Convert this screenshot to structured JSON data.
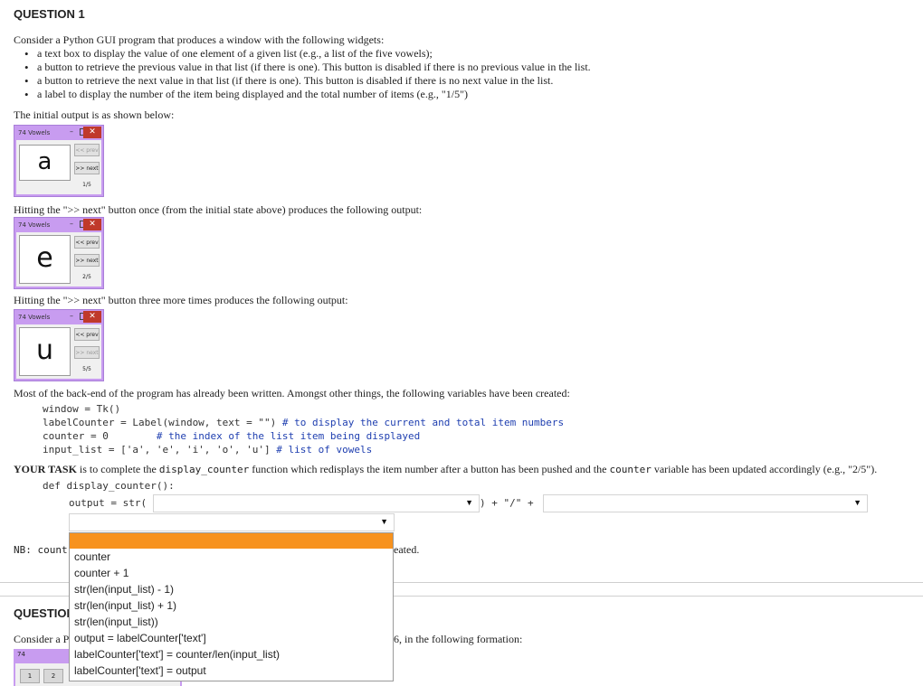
{
  "q1": {
    "title": "QUESTION 1",
    "intro": "Consider a Python GUI program that produces a window with the following widgets:",
    "bullets": [
      "a text box to display the value of one element of a given list (e.g., a list of the five vowels);",
      "a button to retrieve the previous value in that list (if there is one).  This button is disabled if there is no previous value in the list.",
      "a button to retrieve the next value in that list (if there is one).  This button is disabled if there is no next value in the list.",
      "a label to display the number of the item being displayed and the total number of items (e.g., \"1/5\")"
    ],
    "initial_text": "The initial output is as shown below:",
    "after_one_text": "Hitting the \">> next\" button once (from the initial state above) produces the following output:",
    "after_three_text": "Hitting the \">> next\" button three more times produces the following output:",
    "windows": [
      {
        "title": "Vowels",
        "letter": "a",
        "prev": "<< prev",
        "next": ">> next",
        "count": "1/5"
      },
      {
        "title": "Vowels",
        "letter": "e",
        "prev": "<< prev",
        "next": ">> next",
        "count": "2/5"
      },
      {
        "title": "Vowels",
        "letter": "u",
        "prev": "<< prev",
        "next": ">> next",
        "count": "5/5"
      }
    ],
    "backend_text": "Most of the back-end of the program has already been written.  Amongst other things, the following variables have been created:",
    "code": {
      "l1": "window = Tk()",
      "l2a": "labelCounter = Label(window, text = \"\") ",
      "l2b": "# to display the current and total item numbers",
      "l3a": "counter = 0        ",
      "l3b": "# the index of the list item being displayed",
      "l4a": "input_list = ['a', 'e', 'i', 'o', 'u'] ",
      "l4b": "# list of vowels"
    },
    "task_bold": "YOUR TASK",
    "task_1": " is to complete the ",
    "task_code1": "display_counter",
    "task_2": " function which redisplays the item number after a button has been pushed and the ",
    "task_code2": "counter",
    "task_3": " variable has been updated accordingly (e.g., \"2/5\").",
    "def_line": "def display_counter():",
    "output_line": "output = str(",
    "concat": ") + \"/\" + ",
    "nb_start": "NB: count",
    "nb_end": "eated."
  },
  "dropdown": {
    "selected": "",
    "options": [
      "counter",
      "counter + 1",
      "str(len(input_list) - 1)",
      "str(len(input_list) + 1)",
      "str(len(input_list))",
      "output = labelCounter['text']",
      "labelCounter['text'] = counter/len(input_list)",
      "labelCounter['text'] = output"
    ]
  },
  "q2": {
    "title": "QUESTION",
    "intro_start": "Consider a P",
    "intro_end": "6, in the following formation:",
    "keys": [
      "1",
      "2"
    ]
  },
  "colors": {
    "highlight": "#f7921e",
    "tk_frame": "#c89cf0",
    "code_comment": "#1f3fb0"
  }
}
